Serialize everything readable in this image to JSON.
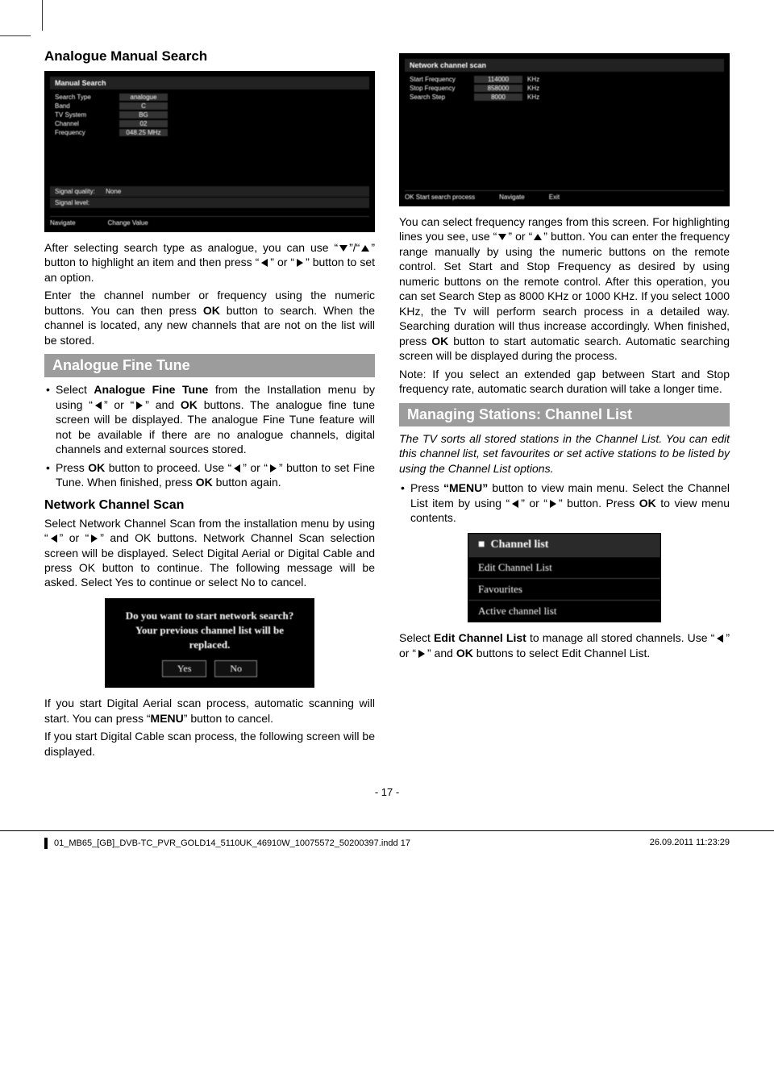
{
  "left": {
    "heading1": "Analogue Manual Search",
    "ss1": {
      "title": "Manual Search",
      "rows": [
        {
          "label": "Search Type",
          "value": "analogue"
        },
        {
          "label": "Band",
          "value": "C"
        },
        {
          "label": "TV System",
          "value": "BG"
        },
        {
          "label": "Channel",
          "value": "02"
        },
        {
          "label": "Frequency",
          "value": "048.25 MHz"
        }
      ],
      "quality_label": "Signal quality:",
      "quality_value": "None",
      "level_label": "Signal level:",
      "nav_left": "Navigate",
      "nav_right": "Change Value"
    },
    "p1_a": "After selecting search type as analogue, you can use “",
    "p1_b": "”/“",
    "p1_c": "” button to highlight an item and then press “",
    "p1_d": "” or “",
    "p1_e": "” button to set an option.",
    "p2_a": "Enter the channel number or frequency using the numeric buttons. You can then press ",
    "p2_ok": "OK",
    "p2_b": " button to search. When the channel is located, any new channels that are not on the list will be stored.",
    "band1": "Analogue Fine Tune",
    "li1_a": "Select ",
    "li1_bold": "Analogue Fine Tune",
    "li1_b": " from the Installation menu by using “",
    "li1_c": "” or “",
    "li1_d": "” and ",
    "li1_ok": "OK",
    "li1_e": " buttons. The analogue fine tune screen will be displayed. The analogue Fine Tune feature will not be available if there are no analogue channels, digital channels and external sources stored.",
    "li2_a": "Press ",
    "li2_ok1": "OK",
    "li2_b": " button to proceed. Use “",
    "li2_c": "” or “",
    "li2_d": "” button to set Fine Tune. When finished, press ",
    "li2_ok2": "OK",
    "li2_e": " button again.",
    "heading2": "Network Channel Scan",
    "p3_a": "Select Network Channel Scan from the installation menu by using “",
    "p3_b": "” or “",
    "p3_c": "” and OK buttons. Network Channel Scan selection screen will be displayed. Select Digital Aerial or Digital Cable and press OK button to continue. The following message will be asked. Select Yes to continue or select No to cancel.",
    "dialog": {
      "line1": "Do you want to start network search?",
      "line2": "Your previous channel list will be",
      "line3": "replaced.",
      "yes": "Yes",
      "no": "No"
    },
    "p4_a": "If you start Digital Aerial scan process, automatic scanning will start. You can press “",
    "p4_menu": "MENU",
    "p4_b": "” button to cancel.",
    "p5": "If you start Digital Cable scan process, the following screen will be displayed."
  },
  "right": {
    "ss2": {
      "title": "Network channel scan",
      "rows": [
        {
          "label": "Start Frequency",
          "value": "114000",
          "unit": "KHz"
        },
        {
          "label": "Stop Frequency",
          "value": "858000",
          "unit": "KHz"
        },
        {
          "label": "Search Step",
          "value": "8000",
          "unit": "KHz"
        }
      ],
      "nav1": "OK Start search process",
      "nav2": "Navigate",
      "nav3": "Exit"
    },
    "p1_a": "You can select frequency ranges from this screen. For highlighting lines you see, use “",
    "p1_b": "” or “",
    "p1_c": "” button. You can enter the frequency range manually by using the numeric buttons on the remote control. Set Start and Stop Frequency as desired by using numeric buttons on the remote control. After this operation, you can set Search Step as 8000 KHz or 1000 KHz. If you select 1000 KHz, the Tv will perform search process in a detailed way. Searching duration will thus increase accordingly. When finished, press ",
    "p1_ok": "OK",
    "p1_d": " button to start automatic search. Automatic searching screen will be displayed during the process.",
    "note": "Note: If you select an extended gap between Start and Stop frequency rate, automatic search duration will take a longer time.",
    "band2": "Managing Stations: Channel List",
    "intro": "The TV sorts all stored stations in the Channel List. You can edit this channel list, set favourites or set active stations to be listed by using the Channel List options.",
    "li1_a": "Press ",
    "li1_menu": "“MENU”",
    "li1_b": " button to view main menu. Select the Channel List item by using “",
    "li1_c": "” or “",
    "li1_d": "” button. Press ",
    "li1_ok": "OK",
    "li1_e": " to view menu contents.",
    "menu": {
      "title": "Channel list",
      "items": [
        "Edit Channel List",
        "Favourites",
        "Active channel list"
      ]
    },
    "p2_a": "Select ",
    "p2_bold": "Edit Channel List",
    "p2_b": " to manage all stored channels. Use “",
    "p2_c": "” or “",
    "p2_d": "”  and ",
    "p2_ok": "OK",
    "p2_e": " buttons to select Edit Channel List."
  },
  "pagenum": "- 17 -",
  "footer": {
    "file": "01_MB65_[GB]_DVB-TC_PVR_GOLD14_5110UK_46910W_10075572_50200397.indd   17",
    "date": "26.09.2011   11:23:29"
  }
}
